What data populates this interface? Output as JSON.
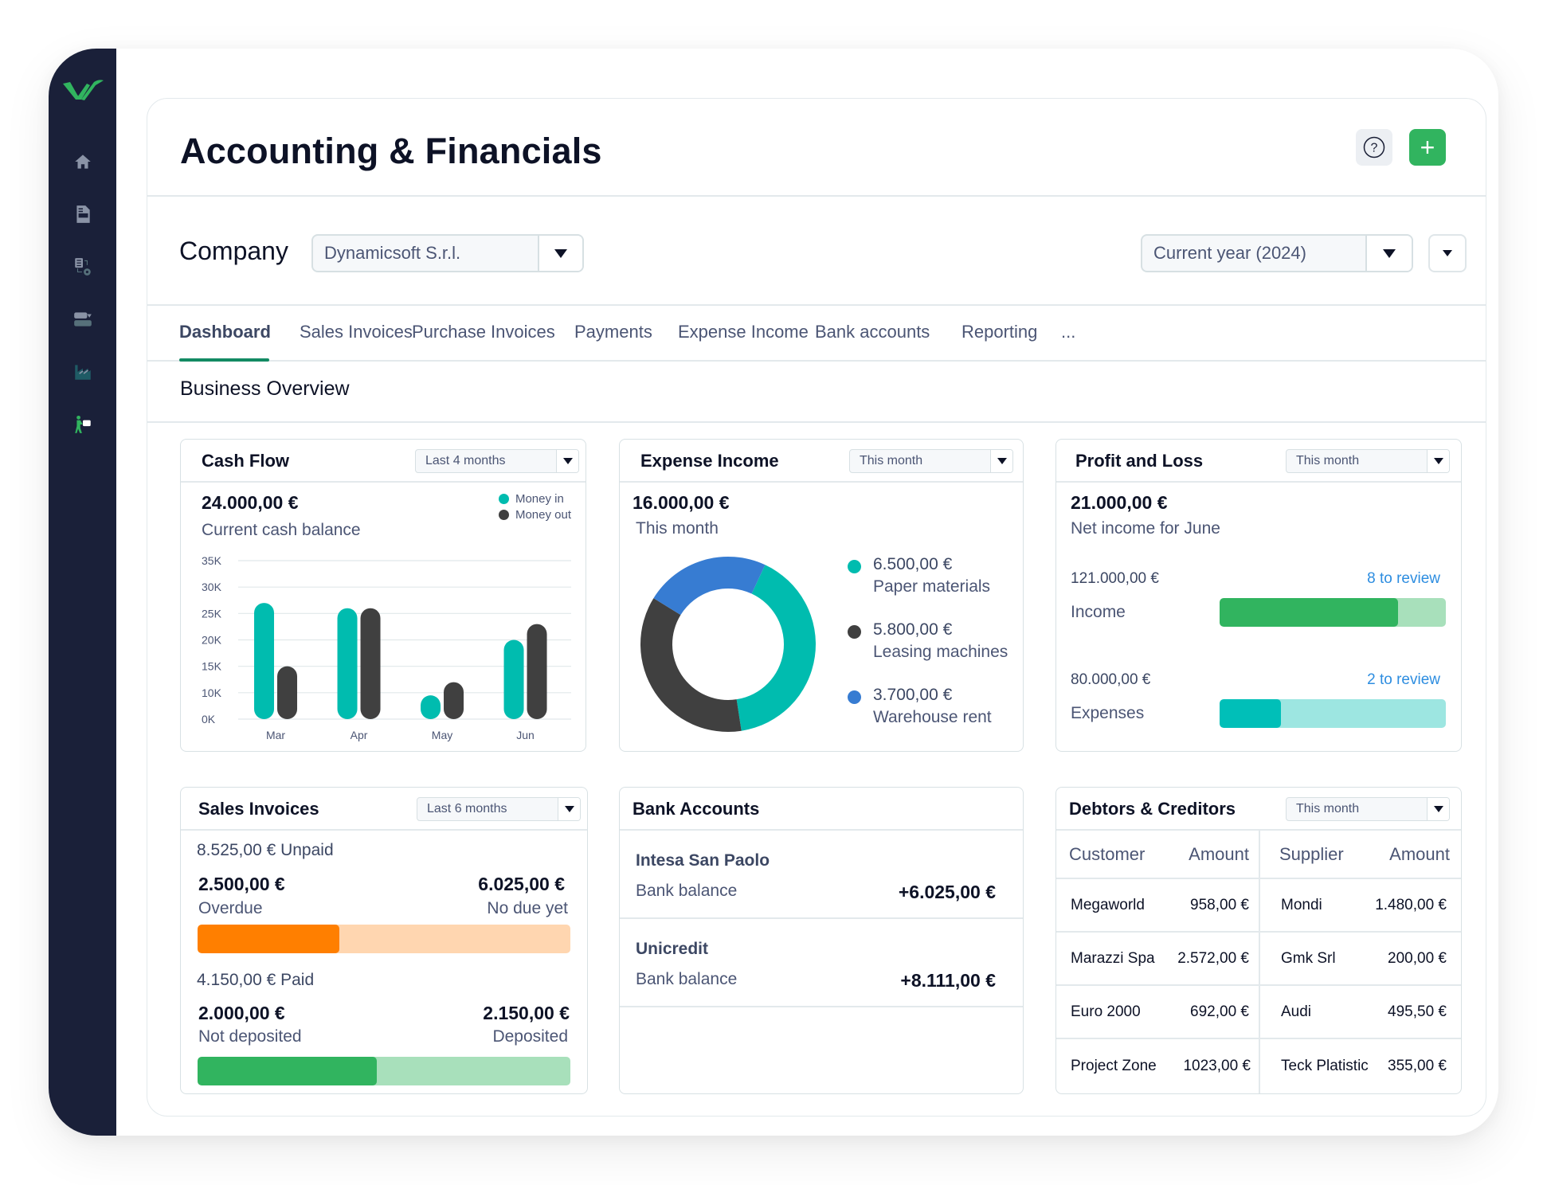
{
  "app": {
    "title": "Accounting & Financials",
    "help_label": "?",
    "add_label": "+"
  },
  "colors": {
    "sidebar_bg": "#1a2039",
    "brand_green": "#31b45f",
    "teal": "#00bcaf",
    "dark": "#404040",
    "blue": "#377cd2",
    "orange": "#ff7f00",
    "link_blue": "#2d8de0"
  },
  "sidebar": {
    "items": [
      {
        "icon": "home-icon"
      },
      {
        "icon": "invoice-document-icon"
      },
      {
        "icon": "document-settings-icon"
      },
      {
        "icon": "transfer-icon"
      },
      {
        "icon": "chart-icon"
      },
      {
        "icon": "person-delivery-icon",
        "active": true
      }
    ]
  },
  "filters": {
    "company_label": "Company",
    "company_value": "Dynamicsoft S.r.l.",
    "period_value": "Current year (2024)"
  },
  "tabs": [
    {
      "label": "Dashboard",
      "active": true
    },
    {
      "label": "Sales Invoices"
    },
    {
      "label": "Purchase Invoices"
    },
    {
      "label": "Payments"
    },
    {
      "label": "Expense Income"
    },
    {
      "label": "Bank accounts"
    },
    {
      "label": "Reporting"
    },
    {
      "label": "..."
    }
  ],
  "overview_title": "Business Overview",
  "cash_flow": {
    "title": "Cash Flow",
    "range": "Last 4 months",
    "amount": "24.000,00 €",
    "label": "Current cash balance",
    "legend": [
      "Money in",
      "Money out"
    ]
  },
  "expense_income": {
    "title": "Expense Income",
    "range": "This month",
    "amount": "16.000,00 €",
    "label": "This month",
    "items": [
      {
        "amount": "6.500,00 €",
        "name": "Paper materials",
        "value": 6500,
        "color": "#00bcaf"
      },
      {
        "amount": "5.800,00 €",
        "name": "Leasing machines",
        "value": 5800,
        "color": "#404040"
      },
      {
        "amount": "3.700,00 €",
        "name": "Warehouse rent",
        "value": 3700,
        "color": "#377cd2"
      }
    ]
  },
  "profit_loss": {
    "title": "Profit and Loss",
    "range": "This month",
    "amount": "21.000,00 €",
    "label": "Net income for June",
    "income": {
      "amount": "121.000,00 €",
      "review": "8 to review",
      "label": "Income",
      "progress": 0.79
    },
    "expenses": {
      "amount": "80.000,00 €",
      "review": "2 to review",
      "label": "Expenses",
      "progress": 0.27
    }
  },
  "sales_invoices": {
    "title": "Sales Invoices",
    "range": "Last 6 months",
    "unpaid_header": "8.525,00 € Unpaid",
    "overdue_amount": "2.500,00 €",
    "overdue_label": "Overdue",
    "not_due_amount": "6.025,00 €",
    "not_due_label": "No due yet",
    "unpaid_progress": 0.38,
    "paid_header": "4.150,00 € Paid",
    "not_deposited_amount": "2.000,00 €",
    "not_deposited_label": "Not deposited",
    "deposited_amount": "2.150,00 €",
    "deposited_label": "Deposited",
    "paid_progress": 0.48
  },
  "bank_accounts": {
    "title": "Bank Accounts",
    "accounts": [
      {
        "name": "Intesa San Paolo",
        "label": "Bank balance",
        "amount": "+6.025,00 €"
      },
      {
        "name": "Unicredit",
        "label": "Bank balance",
        "amount": "+8.111,00 €"
      }
    ]
  },
  "debtors_creditors": {
    "title": "Debtors & Creditors",
    "range": "This month",
    "headers": [
      "Customer",
      "Amount",
      "Supplier",
      "Amount"
    ],
    "rows": [
      [
        "Megaworld",
        "958,00 €",
        "Mondi",
        "1.480,00 €"
      ],
      [
        "Marazzi Spa",
        "2.572,00 €",
        "Gmk Srl",
        "200,00 €"
      ],
      [
        "Euro 2000",
        "692,00 €",
        "Audi",
        "495,50 €"
      ],
      [
        "Project Zone",
        "1023,00 €",
        "Teck Platistic",
        "355,00 €"
      ]
    ]
  },
  "chart_data": [
    {
      "type": "bar",
      "title": "Cash Flow",
      "categories": [
        "Mar",
        "Apr",
        "May",
        "Jun"
      ],
      "series": [
        {
          "name": "Money in",
          "color": "#00bcaf",
          "values": [
            27000,
            26000,
            9000,
            20000
          ]
        },
        {
          "name": "Money out",
          "color": "#404040",
          "values": [
            15000,
            26000,
            12000,
            23000
          ]
        }
      ],
      "yticks": [
        "0K",
        "10K",
        "15K",
        "20K",
        "25K",
        "30K",
        "35K"
      ],
      "ytick_values": [
        0,
        10000,
        15000,
        20000,
        25000,
        30000,
        35000
      ],
      "ylim": [
        0,
        35000
      ],
      "grid": true,
      "legend": "top-right",
      "xlabel": "",
      "ylabel": ""
    },
    {
      "type": "pie",
      "title": "Expense Income",
      "categories": [
        "Paper materials",
        "Leasing machines",
        "Warehouse rent"
      ],
      "values": [
        6500,
        5800,
        3700
      ],
      "colors": [
        "#00bcaf",
        "#404040",
        "#377cd2"
      ],
      "donut": true
    }
  ]
}
